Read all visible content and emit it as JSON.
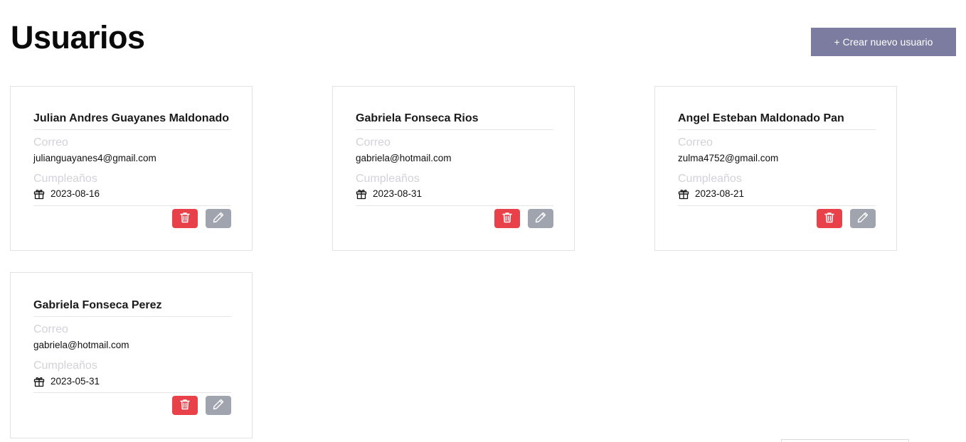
{
  "page": {
    "title": "Usuarios",
    "create_button_label": "+ Crear nuevo usuario"
  },
  "labels": {
    "email": "Correo",
    "birthday": "Cumpleaños"
  },
  "icons": {
    "birthday": "gift-icon",
    "delete": "trash-icon",
    "edit": "pencil-icon"
  },
  "colors": {
    "create_button": "#7b7c9f",
    "delete_button": "#e8414a",
    "edit_button": "#a0a4ae",
    "muted_label": "#d2d2d9"
  },
  "users": [
    {
      "name": "Julian Andres Guayanes Maldonado",
      "email": "julianguayanes4@gmail.com",
      "birthday": "2023-08-16"
    },
    {
      "name": "Gabriela Fonseca Rios",
      "email": "gabriela@hotmail.com",
      "birthday": "2023-08-31"
    },
    {
      "name": "Angel Esteban Maldonado Pan",
      "email": "zulma4752@gmail.com",
      "birthday": "2023-08-21"
    },
    {
      "name": "Gabriela Fonseca Perez",
      "email": "gabriela@hotmail.com",
      "birthday": "2023-05-31"
    }
  ]
}
